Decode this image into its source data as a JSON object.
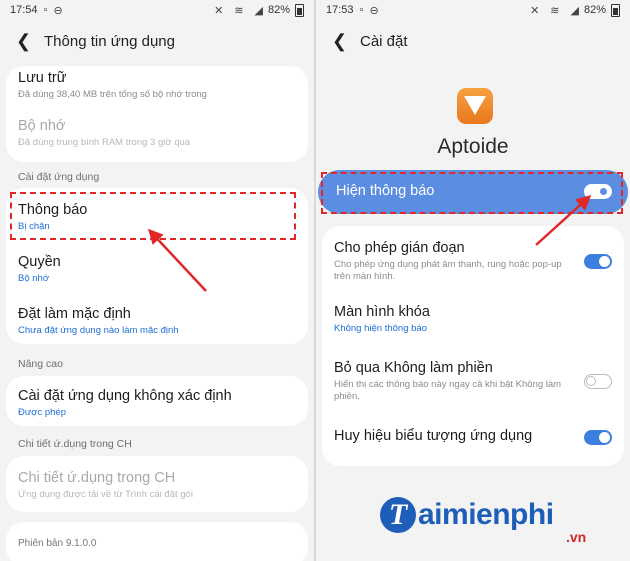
{
  "left": {
    "status": {
      "time": "17:54",
      "battery": "82%"
    },
    "appbar": {
      "title": "Thông tin ứng dụng"
    },
    "storage": {
      "title": "Lưu trữ",
      "subtitle": "Đã dùng 38,40 MB trên tổng số bộ nhớ trong"
    },
    "memory": {
      "title": "Bộ nhớ",
      "subtitle": "Đã dùng trung bình RAM trong 3 giờ qua"
    },
    "section_app_settings": "Cài đặt ứng dụng",
    "notifications": {
      "title": "Thông báo",
      "subtitle": "Bị chặn"
    },
    "permissions": {
      "title": "Quyền",
      "subtitle": "Bộ nhớ"
    },
    "set_default": {
      "title": "Đặt làm mặc định",
      "subtitle": "Chưa đặt ứng dụng nào làm mặc định"
    },
    "section_advanced": "Nâng cao",
    "unknown_apps": {
      "title": "Cài đặt ứng dụng không xác định",
      "subtitle": "Được phép"
    },
    "section_store": "Chi tiết ứ.dụng trong CH",
    "store_details": {
      "title": "Chi tiết ứ.dụng trong CH",
      "subtitle": "Ứng dụng được tải về từ Trình cài đặt gói"
    },
    "version": "Phiên bản 9.1.0.0"
  },
  "right": {
    "status": {
      "time": "17:53",
      "battery": "82%"
    },
    "appbar": {
      "title": "Cài đặt"
    },
    "app_name": "Aptoide",
    "show_notifications": {
      "label": "Hiện thông báo",
      "on": true
    },
    "allow_interruptions": {
      "title": "Cho phép gián đoạn",
      "subtitle": "Cho phép ứng dụng phát âm thanh, rung hoặc pop-up trên màn hình.",
      "on": true
    },
    "lock_screen": {
      "title": "Màn hình khóa",
      "subtitle": "Không hiện thông báo"
    },
    "dnd_override": {
      "title": "Bỏ qua Không làm phiền",
      "subtitle": "Hiển thị các thông báo này ngay cả khi bật Không làm phiền.",
      "on": false
    },
    "app_icon_badges": {
      "title": "Huy hiệu biểu tượng ứng dụng",
      "on": true
    }
  },
  "watermark": {
    "brand": "aimienphi",
    "initial": "T",
    "domain": ".vn"
  },
  "colors": {
    "accent": "#3d7fe0",
    "highlight_bar": "#5b8de0",
    "annotation_red": "#e12727",
    "link_blue": "#1d6fd6"
  }
}
